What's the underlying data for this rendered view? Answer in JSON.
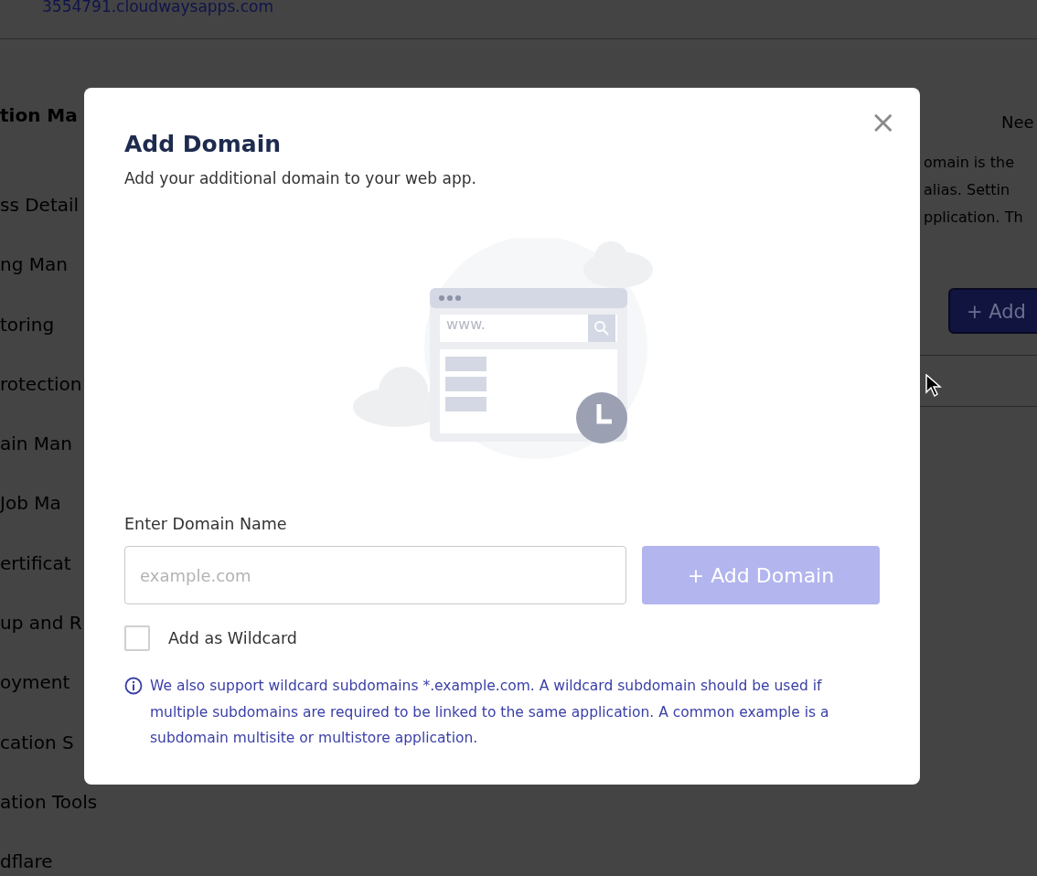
{
  "background_page": {
    "url": "3554791.cloudwaysapps.com",
    "sidebar_items": [
      "tion Ma",
      "ss Detail",
      "ng Man",
      "toring",
      "rotection",
      "ain Man",
      "Job Ma",
      "ertificat",
      "up and R",
      "oyment",
      "cation S",
      "ation Tools",
      "dflare"
    ],
    "help_link": "Nee",
    "description_lines": [
      "omain is the",
      "alias. Settin",
      "pplication. Th"
    ],
    "add_button": "+ Add"
  },
  "modal": {
    "title": "Add Domain",
    "subtitle": "Add your additional domain to your web app.",
    "close": "×",
    "illustration": {
      "address_text": "www."
    },
    "field": {
      "label": "Enter Domain Name",
      "placeholder": "example.com"
    },
    "add_button": {
      "label": "+ Add Domain",
      "disabled": true
    },
    "wildcard": {
      "label": "Add as Wildcard",
      "checked": false
    },
    "info": "We also support wildcard subdomains *.example.com. A wildcard subdomain should be used if multiple subdomains are required to be linked to the same application. A common example is a subdomain multisite or multistore application."
  }
}
